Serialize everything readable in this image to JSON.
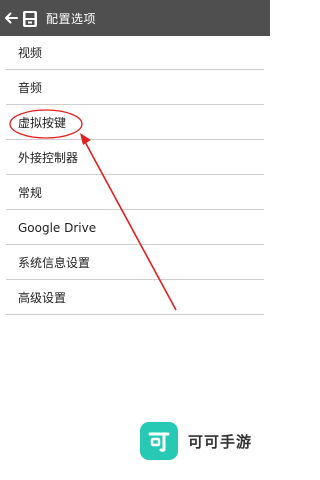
{
  "appbar": {
    "title": "配置选项",
    "back_icon": "arrow-left-icon",
    "app_icon": "handheld-console-icon"
  },
  "menu": {
    "items": [
      {
        "label": "视频"
      },
      {
        "label": "音频"
      },
      {
        "label": "虚拟按键"
      },
      {
        "label": "外接控制器"
      },
      {
        "label": "常规"
      },
      {
        "label": "Google Drive"
      },
      {
        "label": "系统信息设置"
      },
      {
        "label": "高级设置"
      }
    ]
  },
  "annotation": {
    "color": "#e02020",
    "highlighted_item": "虚拟按键"
  },
  "watermark": {
    "icon_glyph": "可",
    "text": "可可手游",
    "icon_color": "#27c9b5"
  }
}
